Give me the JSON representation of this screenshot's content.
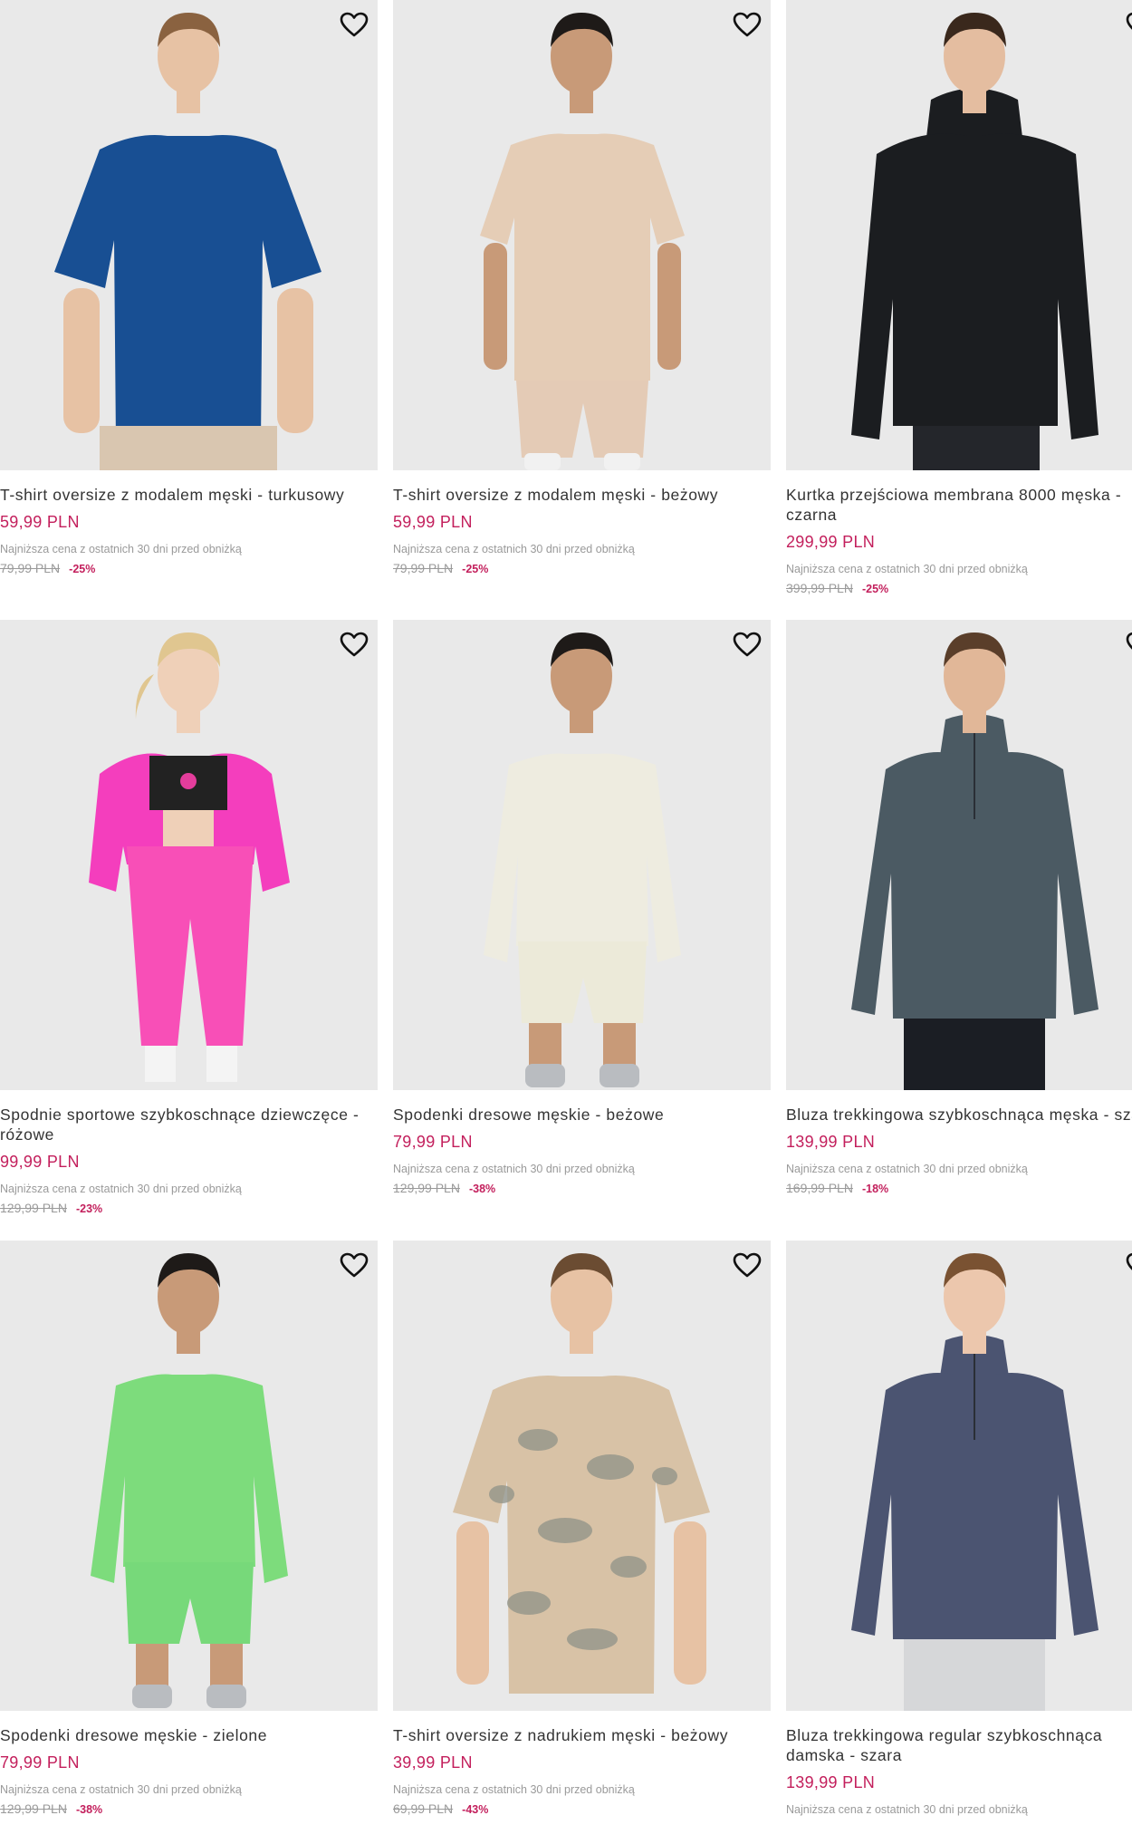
{
  "accent_color": "#c31f5c",
  "products": [
    {
      "title": "T-shirt oversize z modalem męski - turkusowy",
      "price": "59,99 PLN",
      "lowest_label": "Najniższa cena z ostatnich 30 dni przed obniżką",
      "old_price": "79,99 PLN",
      "discount": "-25%",
      "garment_color": "#184f93",
      "pants_color": "#d9c6b0",
      "skin": "#e7c2a4",
      "hair": "#8a6240",
      "style": "tee",
      "wishlist_icon": "heart-outline-icon"
    },
    {
      "title": "T-shirt oversize z modalem męski - beżowy",
      "price": "59,99 PLN",
      "lowest_label": "Najniższa cena z ostatnich 30 dni przed obniżką",
      "old_price": "79,99 PLN",
      "discount": "-25%",
      "garment_color": "#e5cdb6",
      "pants_color": "#e4cbb6",
      "skin": "#c89a78",
      "hair": "#1e1a18",
      "style": "tee-full",
      "wishlist_icon": "heart-outline-icon"
    },
    {
      "title": "Kurtka przejściowa membrana 8000 męska - czarna",
      "price": "299,99 PLN",
      "lowest_label": "Najniższa cena z ostatnich 30 dni przed obniżką",
      "old_price": "399,99 PLN",
      "discount": "-25%",
      "garment_color": "#1b1d20",
      "pants_color": "#1b1d20",
      "skin": "#e4bda0",
      "hair": "#3a281c",
      "style": "jacket",
      "wishlist_icon": "heart-outline-icon"
    },
    {
      "title": "Spodnie sportowe szybkoschnące dziewczęce - różowe",
      "price": "99,99 PLN",
      "lowest_label": "Najniższa cena z ostatnich 30 dni przed obniżką",
      "old_price": "129,99 PLN",
      "discount": "-23%",
      "garment_color": "#f43ebd",
      "pants_color": "#f84fb7",
      "skin": "#efd0b8",
      "hair": "#e0c690",
      "style": "girl",
      "wishlist_icon": "heart-outline-icon"
    },
    {
      "title": "Spodenki dresowe męskie - beżowe",
      "price": "79,99 PLN",
      "lowest_label": "Najniższa cena z ostatnich 30 dni przed obniżką",
      "old_price": "129,99 PLN",
      "discount": "-38%",
      "garment_color": "#eeece0",
      "pants_color": "#ecead9",
      "skin": "#c89a78",
      "hair": "#1e1a18",
      "style": "shorts",
      "wishlist_icon": "heart-outline-icon"
    },
    {
      "title": "Bluza trekkingowa szybkoschnąca męska - szara",
      "price": "139,99 PLN",
      "lowest_label": "Najniższa cena z ostatnich 30 dni przed obniżką",
      "old_price": "169,99 PLN",
      "discount": "-18%",
      "garment_color": "#4b5a63",
      "pants_color": "#1b1e24",
      "skin": "#e1b798",
      "hair": "#5a3e2a",
      "style": "longsleeve",
      "wishlist_icon": "heart-outline-icon"
    },
    {
      "title": "Spodenki dresowe męskie - zielone",
      "price": "79,99 PLN",
      "lowest_label": "Najniższa cena z ostatnich 30 dni przed obniżką",
      "old_price": "129,99 PLN",
      "discount": "-38%",
      "garment_color": "#7ddc7c",
      "pants_color": "#77d97a",
      "skin": "#c89a78",
      "hair": "#1e1a18",
      "style": "shorts",
      "wishlist_icon": "heart-outline-icon"
    },
    {
      "title": "T-shirt oversize z nadrukiem męski - beżowy",
      "price": "39,99 PLN",
      "lowest_label": "Najniższa cena z ostatnich 30 dni przed obniżką",
      "old_price": "69,99 PLN",
      "discount": "-43%",
      "garment_color": "#d8c2a6",
      "pants_color": "#e2d3c2",
      "skin": "#e7c2a4",
      "hair": "#6b4c32",
      "style": "tee-print",
      "wishlist_icon": "heart-outline-icon"
    },
    {
      "title": "Bluza trekkingowa regular szybkoschnąca damska - szara",
      "price": "139,99 PLN",
      "lowest_label": "Najniższa cena z ostatnich 30 dni przed obniżką",
      "old_price": "",
      "discount": "",
      "garment_color": "#4b5471",
      "pants_color": "#d6d7d9",
      "skin": "#ecc7ad",
      "hair": "#7a5232",
      "style": "longsleeve-w",
      "wishlist_icon": "heart-outline-icon"
    }
  ]
}
